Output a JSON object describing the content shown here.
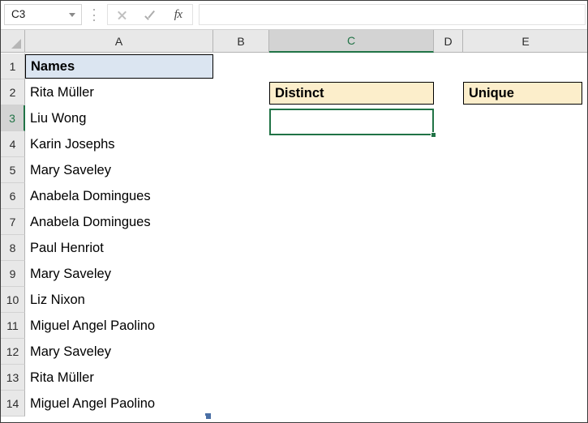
{
  "app": {
    "name_box_value": "C3",
    "name_box_placeholder": "Name Box",
    "formula_value": "",
    "formula_placeholder": "",
    "icons": {
      "dropdown": "chevron-down-icon",
      "cancel": "cancel-x-icon",
      "enter": "enter-check-icon",
      "insert_function": "fx-icon",
      "select_all": "select-all-triangle-icon",
      "scroll_marker": "scroll-marker-icon"
    },
    "fx_label": "fx"
  },
  "grid": {
    "column_headers": [
      "A",
      "B",
      "C",
      "D",
      "E"
    ],
    "selected_column": "C",
    "row_headers": [
      "1",
      "2",
      "3",
      "4",
      "5",
      "6",
      "7",
      "8",
      "9",
      "10",
      "11",
      "12",
      "13",
      "14"
    ],
    "selected_row": "3",
    "selected_cell": "C3"
  },
  "cells": {
    "a1": "Names",
    "a_values": [
      "Rita Müller",
      "Liu Wong",
      "Karin Josephs",
      "Mary Saveley",
      "Anabela Domingues",
      "Anabela Domingues",
      "Paul Henriot",
      "Mary Saveley",
      "Liz Nixon",
      "Miguel Angel Paolino",
      "Mary Saveley",
      "Rita Müller",
      "Miguel Angel Paolino"
    ],
    "c2": "Distinct",
    "e2": "Unique",
    "c3": ""
  },
  "colors": {
    "excel_green": "#217346",
    "header_blue_fill": "#dbe5f1",
    "header_cream_fill": "#fceecb",
    "grid_header_gray": "#e8e8e8",
    "selected_header_gray": "#d3d3d3"
  }
}
